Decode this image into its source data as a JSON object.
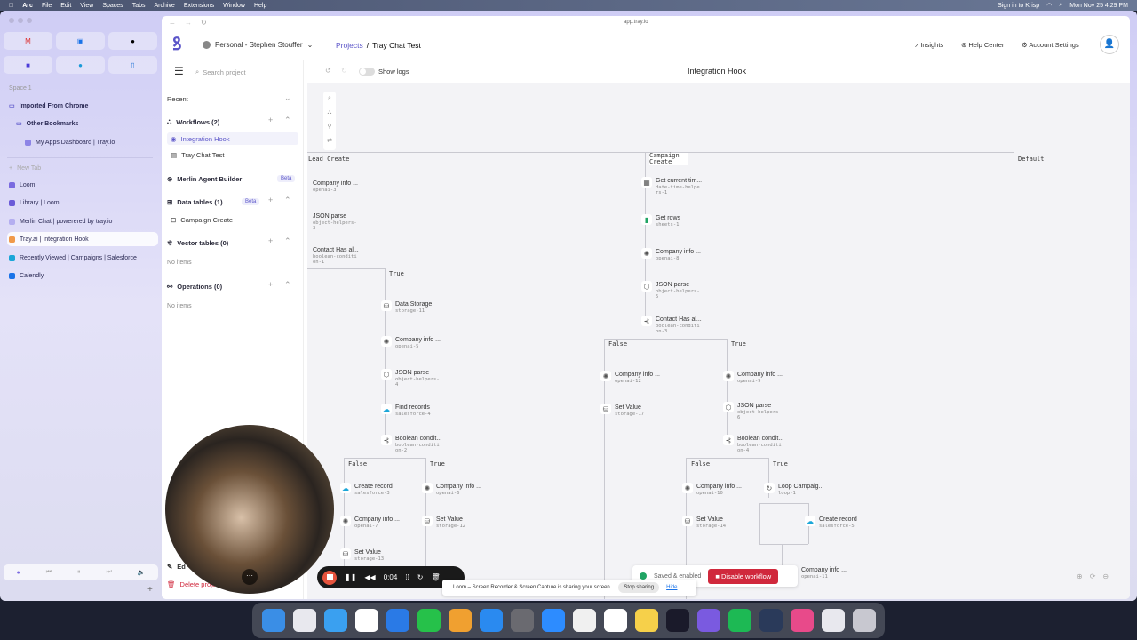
{
  "menubar": {
    "items": [
      "Arc",
      "File",
      "Edit",
      "View",
      "Spaces",
      "Tabs",
      "Archive",
      "Extensions",
      "Window",
      "Help"
    ],
    "krisp": "Sign in to Krisp",
    "datetime": "Mon Nov 25  4:29 PM"
  },
  "arc_sidebar": {
    "space": "Space 1",
    "folder": "Imported From Chrome",
    "subfolder": "Other Bookmarks",
    "bookmark": "My Apps Dashboard | Tray.io",
    "new_tab": "New Tab",
    "tabs": [
      {
        "label": "Loom",
        "color": "#7a6ae0"
      },
      {
        "label": "Library | Loom",
        "color": "#6a5ad8"
      },
      {
        "label": "Merlin Chat | powerered by tray.io",
        "color": "#b4aef0"
      },
      {
        "label": "Tray.ai | Integration Hook",
        "color": "#f09a4a",
        "active": true
      },
      {
        "label": "Recently Viewed | Campaigns | Salesforce",
        "color": "#1aa6d8"
      },
      {
        "label": "Calendly",
        "color": "#1a73e8"
      }
    ]
  },
  "browser": {
    "url": "app.tray.io"
  },
  "header": {
    "workspace": "Personal - Stephen Stouffer",
    "breadcrumb_root": "Projects",
    "breadcrumb_sep": "/",
    "project": "Tray Chat Test",
    "insights": "Insights",
    "help": "Help Center",
    "account": "Account Settings"
  },
  "left_panel": {
    "search_placeholder": "Search project",
    "recent": "Recent",
    "workflows": {
      "label": "Workflows (2)",
      "items": [
        "Integration Hook",
        "Tray Chat Test"
      ]
    },
    "merlin": {
      "label": "Merlin Agent Builder",
      "badge": "Beta"
    },
    "data_tables": {
      "label": "Data tables (1)",
      "badge": "Beta",
      "items": [
        "Campaign Create"
      ]
    },
    "vector_tables": {
      "label": "Vector tables (0)",
      "empty": "No items"
    },
    "operations": {
      "label": "Operations (0)",
      "empty": "No items"
    },
    "edit": "Ed",
    "delete": "Delete proje"
  },
  "canvas": {
    "show_logs": "Show logs",
    "title": "Integration Hook",
    "show_logs_on": false,
    "trigger_labels": [
      "Lead Create",
      "Campaign Create",
      "Default"
    ],
    "branch_labels": [
      "True",
      "False",
      "True",
      "False",
      "True",
      "False",
      "True"
    ],
    "nodes": [
      {
        "t": "Company info ...",
        "s": "openai-3",
        "i": "openai"
      },
      {
        "t": "JSON parse",
        "s": "object-helpers-3",
        "i": "box"
      },
      {
        "t": "Contact Has al...",
        "s": "boolean-condition-1",
        "i": "branch"
      },
      {
        "t": "Data Storage",
        "s": "storage-11",
        "i": "storage"
      },
      {
        "t": "Company info ...",
        "s": "openai-5",
        "i": "openai"
      },
      {
        "t": "JSON parse",
        "s": "object-helpers-4",
        "i": "box"
      },
      {
        "t": "Find records",
        "s": "salesforce-4",
        "i": "salesforce"
      },
      {
        "t": "Boolean condit...",
        "s": "boolean-condition-2",
        "i": "branch"
      },
      {
        "t": "Create record",
        "s": "salesforce-3",
        "i": "salesforce"
      },
      {
        "t": "Company info ...",
        "s": "openai-7",
        "i": "openai"
      },
      {
        "t": "Set Value",
        "s": "storage-13",
        "i": "storage"
      },
      {
        "t": "Company info ...",
        "s": "openai-6",
        "i": "openai"
      },
      {
        "t": "Set Value",
        "s": "storage-12",
        "i": "storage"
      },
      {
        "t": "Get current tim...",
        "s": "date-time-helpers-1",
        "i": "calendar"
      },
      {
        "t": "Get rows",
        "s": "sheets-1",
        "i": "sheets"
      },
      {
        "t": "Company info ...",
        "s": "openai-8",
        "i": "openai"
      },
      {
        "t": "JSON parse",
        "s": "object-helpers-5",
        "i": "box"
      },
      {
        "t": "Contact Has al...",
        "s": "boolean-condition-3",
        "i": "branch"
      },
      {
        "t": "Company info ...",
        "s": "openai-12",
        "i": "openai"
      },
      {
        "t": "Set Value",
        "s": "storage-17",
        "i": "storage"
      },
      {
        "t": "Company info ...",
        "s": "openai-9",
        "i": "openai"
      },
      {
        "t": "JSON parse",
        "s": "object-helpers-6",
        "i": "box"
      },
      {
        "t": "Boolean condit...",
        "s": "boolean-condition-4",
        "i": "branch"
      },
      {
        "t": "Company info ...",
        "s": "openai-10",
        "i": "openai"
      },
      {
        "t": "Set Value",
        "s": "storage-14",
        "i": "storage"
      },
      {
        "t": "Loop Campaig...",
        "s": "loop-1",
        "i": "loop"
      },
      {
        "t": "Create record",
        "s": "salesforce-5",
        "i": "salesforce"
      },
      {
        "t": "Company info ...",
        "s": "openai-11",
        "i": "openai"
      }
    ],
    "status": "Saved & enabled",
    "disable": "Disable workflow"
  },
  "loom": {
    "time": "0:04",
    "share_msg": "Loom – Screen Recorder & Screen Capture is sharing your screen.",
    "stop": "Stop sharing",
    "hide": "Hide"
  },
  "colors": {
    "accent": "#5b55c9",
    "danger": "#d0283c",
    "salesforce": "#1aa6d8",
    "sheets": "#1fa463"
  }
}
